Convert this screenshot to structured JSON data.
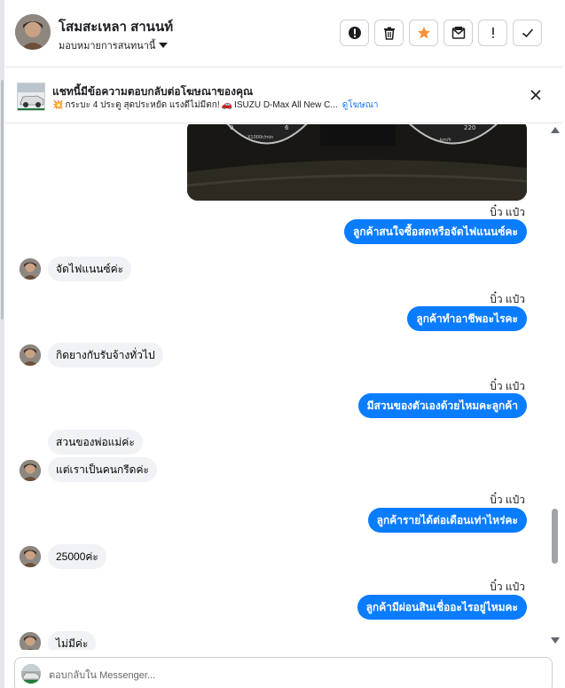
{
  "header": {
    "contact_name": "โสมสะเหลา สานนท์",
    "assign_label": "มอบหมายการสนทนานี้",
    "actions": [
      {
        "icon": "alert-circle-icon",
        "name": "spam-button"
      },
      {
        "icon": "trash-icon",
        "name": "delete-button"
      },
      {
        "icon": "star-icon",
        "name": "star-button",
        "color": "#f7923b"
      },
      {
        "icon": "mark-unread-icon",
        "name": "mark-unread-button"
      },
      {
        "icon": "exclamation-icon",
        "name": "follow-up-button"
      },
      {
        "icon": "check-icon",
        "name": "done-button"
      }
    ]
  },
  "ad": {
    "title": "แชทนี้มีข้อความตอบกลับต่อโฆษณาของคุณ",
    "emoji_left": "💥",
    "subtitle": "กระบะ 4 ประตู สุดประหยัด แรงดีไม่มีตก!",
    "emoji_mid": "🚗",
    "subtitle_tail": "ISUZU D-Max All New C...",
    "link": "ดูโฆษณา"
  },
  "conversation": {
    "messages": [
      {
        "side": "out",
        "type": "image",
        "icon": "dashboard-photo"
      },
      {
        "side": "out",
        "seen": "บิ๋ว แป๋ว",
        "text": "ลูกค้าสนใจซื้อสดหรือจัดไฟแนนซ์คะ"
      },
      {
        "side": "in",
        "text": "จัดไฟแนนซ์ค่ะ"
      },
      {
        "side": "out",
        "seen": "บิ๋ว แป๋ว",
        "text": "ลูกค้าทำอาชีพอะไรคะ"
      },
      {
        "side": "in",
        "text": "กิดยางกับรับจ้างทั่วไป"
      },
      {
        "side": "out",
        "seen": "บิ๋ว แป๋ว",
        "text": "มีสวนของตัวเองด้วยไหมคะลูกค้า"
      },
      {
        "side": "in",
        "text": "สวนของพ่อแม่ค่ะ"
      },
      {
        "side": "in",
        "text": "แต่เราเป็นคนกรีดค่ะ"
      },
      {
        "side": "out",
        "seen": "บิ๋ว แป๋ว",
        "text": "ลูกค้ารายได้ต่อเดือนเท่าไหร่คะ"
      },
      {
        "side": "in",
        "text": "25000ค่ะ"
      },
      {
        "side": "out",
        "seen": "บิ๋ว แป๋ว",
        "text": "ลูกค้ามีผ่อนสินเชื่ออะไรอยู่ไหมคะ"
      },
      {
        "side": "in",
        "text": "ไม่มีค่ะ"
      }
    ]
  },
  "composer": {
    "placeholder": "ตอบกลับใน Messenger..."
  },
  "colors": {
    "outgoing_bubble": "#0a7cff",
    "incoming_bubble": "#f0f2f5",
    "link": "#1877f2",
    "star": "#f7923b"
  }
}
